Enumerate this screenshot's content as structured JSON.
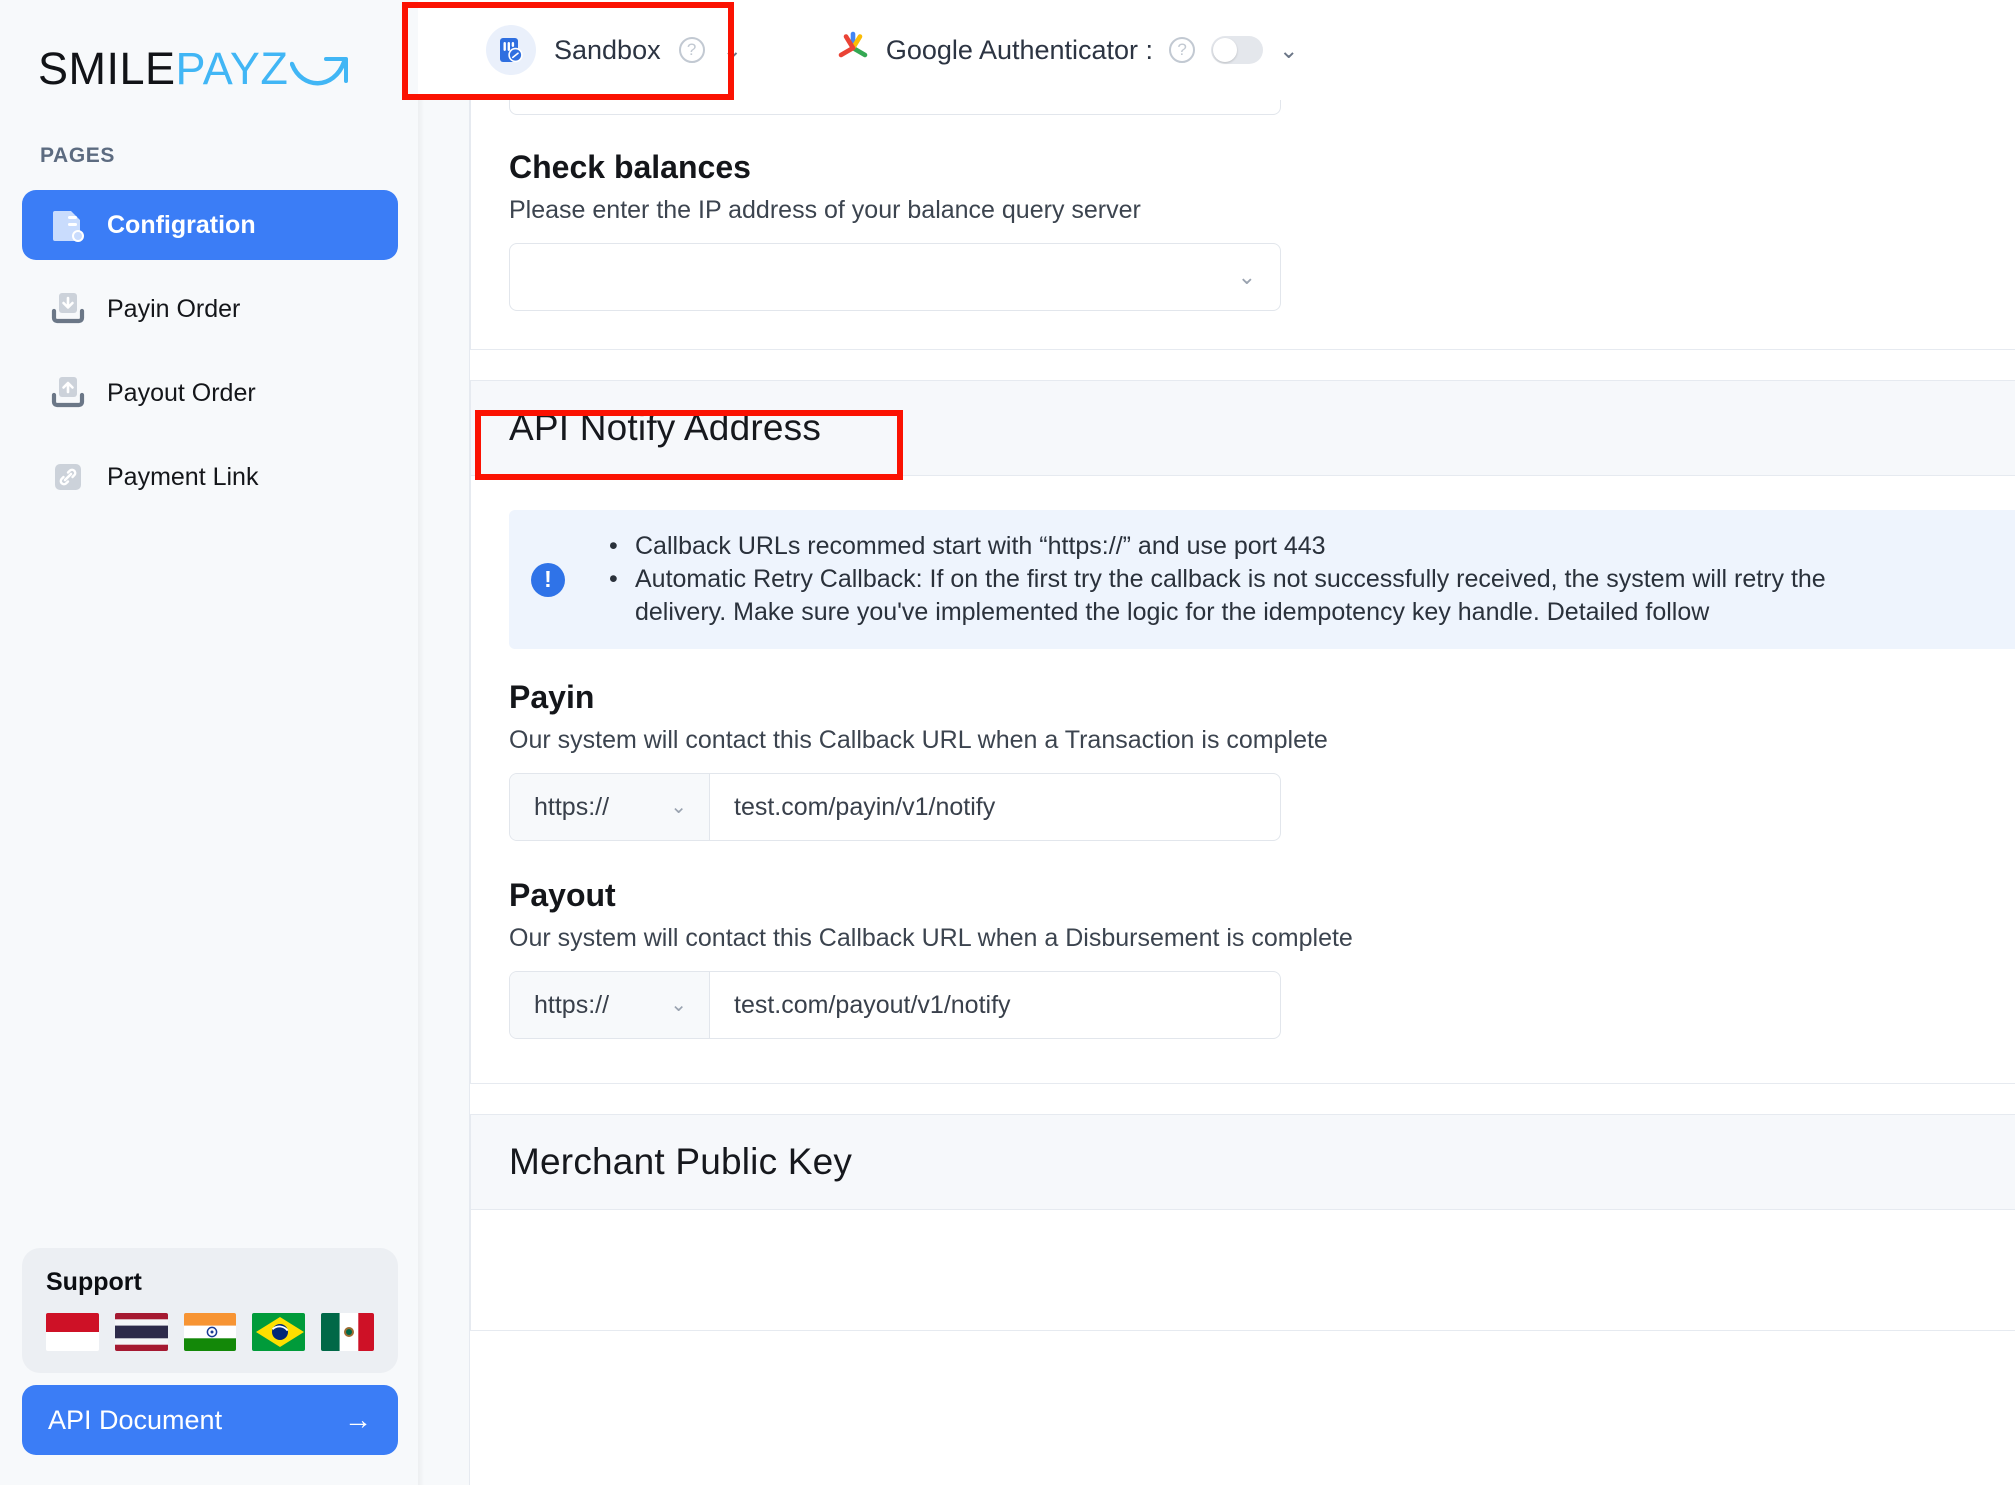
{
  "brand": {
    "logo_primary": "SMILE",
    "logo_secondary": "PAYZ",
    "accent_blue": "#41b6f5",
    "primary_blue": "#3b7df6"
  },
  "sidebar": {
    "section_label": "PAGES",
    "items": [
      {
        "label": "Configration",
        "icon": "document-config-icon",
        "active": true
      },
      {
        "label": "Payin Order",
        "icon": "tray-download-icon",
        "active": false
      },
      {
        "label": "Payout Order",
        "icon": "tray-upload-icon",
        "active": false
      },
      {
        "label": "Payment Link",
        "icon": "link-icon",
        "active": false
      }
    ],
    "support": {
      "title": "Support",
      "flags": [
        {
          "name": "indonesia-flag"
        },
        {
          "name": "thailand-flag"
        },
        {
          "name": "india-flag"
        },
        {
          "name": "brazil-flag"
        },
        {
          "name": "mexico-flag"
        }
      ]
    },
    "api_document": {
      "label": "API Document",
      "arrow": "→"
    }
  },
  "topbar": {
    "environment": {
      "name": "Sandbox",
      "help_icon": "?",
      "chevron": "⌄"
    },
    "google_authenticator": {
      "label": "Google Authenticator :",
      "help_icon": "?",
      "toggle_on": false,
      "chevron": "⌄"
    }
  },
  "content": {
    "check_balances": {
      "title": "Check balances",
      "help": "Please enter the IP address of your balance query server",
      "value": "",
      "chevron": "⌄"
    },
    "api_notify_address": {
      "card_title": "API Notify Address",
      "callout": {
        "icon": "info-exclamation-icon",
        "bullets": [
          "Callback URLs recommed start with “https://” and use port 443",
          "Automatic Retry Callback: If on the first try the callback is not successfully received, the system will retry the",
          "delivery. Make sure you've implemented the logic for the idempotency key handle. Detailed follow"
        ]
      },
      "payin": {
        "title": "Payin",
        "help": "Our system will contact this Callback URL when a Transaction is complete",
        "scheme": "https://",
        "url": "test.com/payin/v1/notify",
        "chevron": "⌄"
      },
      "payout": {
        "title": "Payout",
        "help": "Our system will contact this Callback URL when a Disbursement is complete",
        "scheme": "https://",
        "url": "test.com/payout/v1/notify",
        "chevron": "⌄"
      }
    },
    "merchant_public_key": {
      "card_title": "Merchant Public Key"
    }
  },
  "annotations": {
    "color": "#fb1202",
    "boxes": [
      {
        "name": "sandbox-selector-highlight"
      },
      {
        "name": "api-notify-address-title-highlight"
      }
    ]
  }
}
